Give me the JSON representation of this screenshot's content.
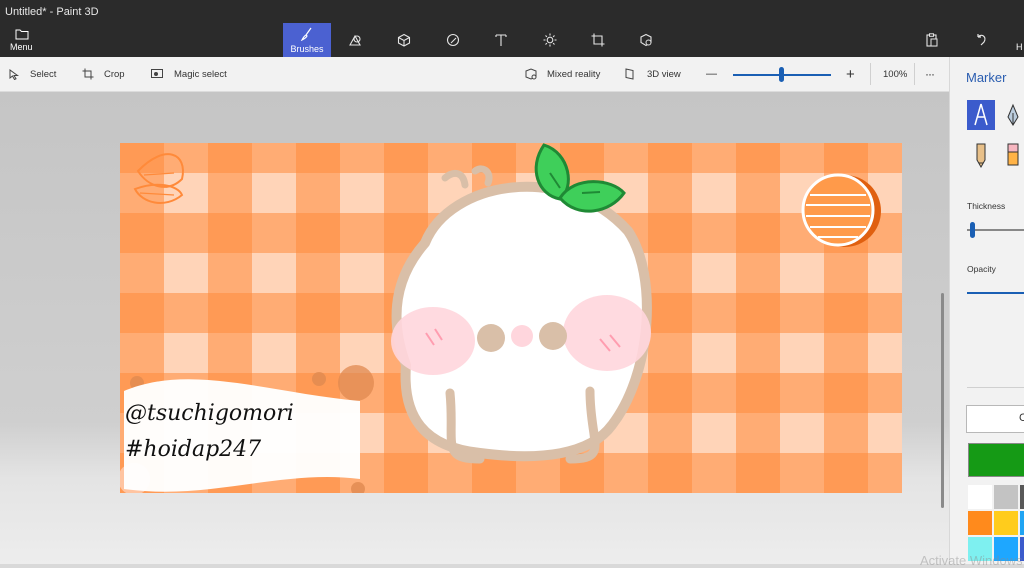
{
  "window": {
    "title": "Untitled* - Paint 3D"
  },
  "titlebar": {
    "menu_label": "Menu",
    "tools": [
      {
        "name": "brushes",
        "label": "Brushes",
        "icon": "brush-icon",
        "active": true
      },
      {
        "name": "2d-shapes",
        "label": "",
        "icon": "2d-shapes-icon"
      },
      {
        "name": "3d-shapes",
        "label": "",
        "icon": "3d-cube-icon"
      },
      {
        "name": "stickers",
        "label": "",
        "icon": "sticker-icon"
      },
      {
        "name": "text",
        "label": "",
        "icon": "text-icon"
      },
      {
        "name": "effects",
        "label": "",
        "icon": "effects-icon"
      },
      {
        "name": "canvas",
        "label": "",
        "icon": "canvas-icon"
      },
      {
        "name": "3d-library",
        "label": "",
        "icon": "3d-library-icon"
      }
    ],
    "right_icons": [
      "paste-icon",
      "undo-icon"
    ],
    "cut_text": "H"
  },
  "toolbar": {
    "select": "Select",
    "crop": "Crop",
    "magic_select": "Magic select",
    "mixed_reality": "Mixed reality",
    "view_3d": "3D view",
    "zoom_minus": "—",
    "zoom_plus": "+",
    "zoom_level": "100%",
    "zoom_fraction": 0.5,
    "more": "···"
  },
  "canvas": {
    "text_line1": "@tsuchigomori",
    "text_line2": "#hoidap247"
  },
  "side_panel": {
    "title": "Marker",
    "brushes": [
      "marker-icon",
      "calligraphy-pen-icon",
      "pencil-icon",
      "eraser-icon"
    ],
    "thickness_label": "Thickness",
    "opacity_label": "Opacity",
    "add_color_fragment": "C",
    "current_color": "#159a15",
    "swatches": [
      "#ffffff",
      "#c3c3c3",
      "#585858",
      "#ff8a1c",
      "#ffcc1c",
      "#20a4f3",
      "#7ef0f0",
      "#1ea7ff",
      "#3b5bcc"
    ]
  },
  "watermark": "Activate Windows"
}
